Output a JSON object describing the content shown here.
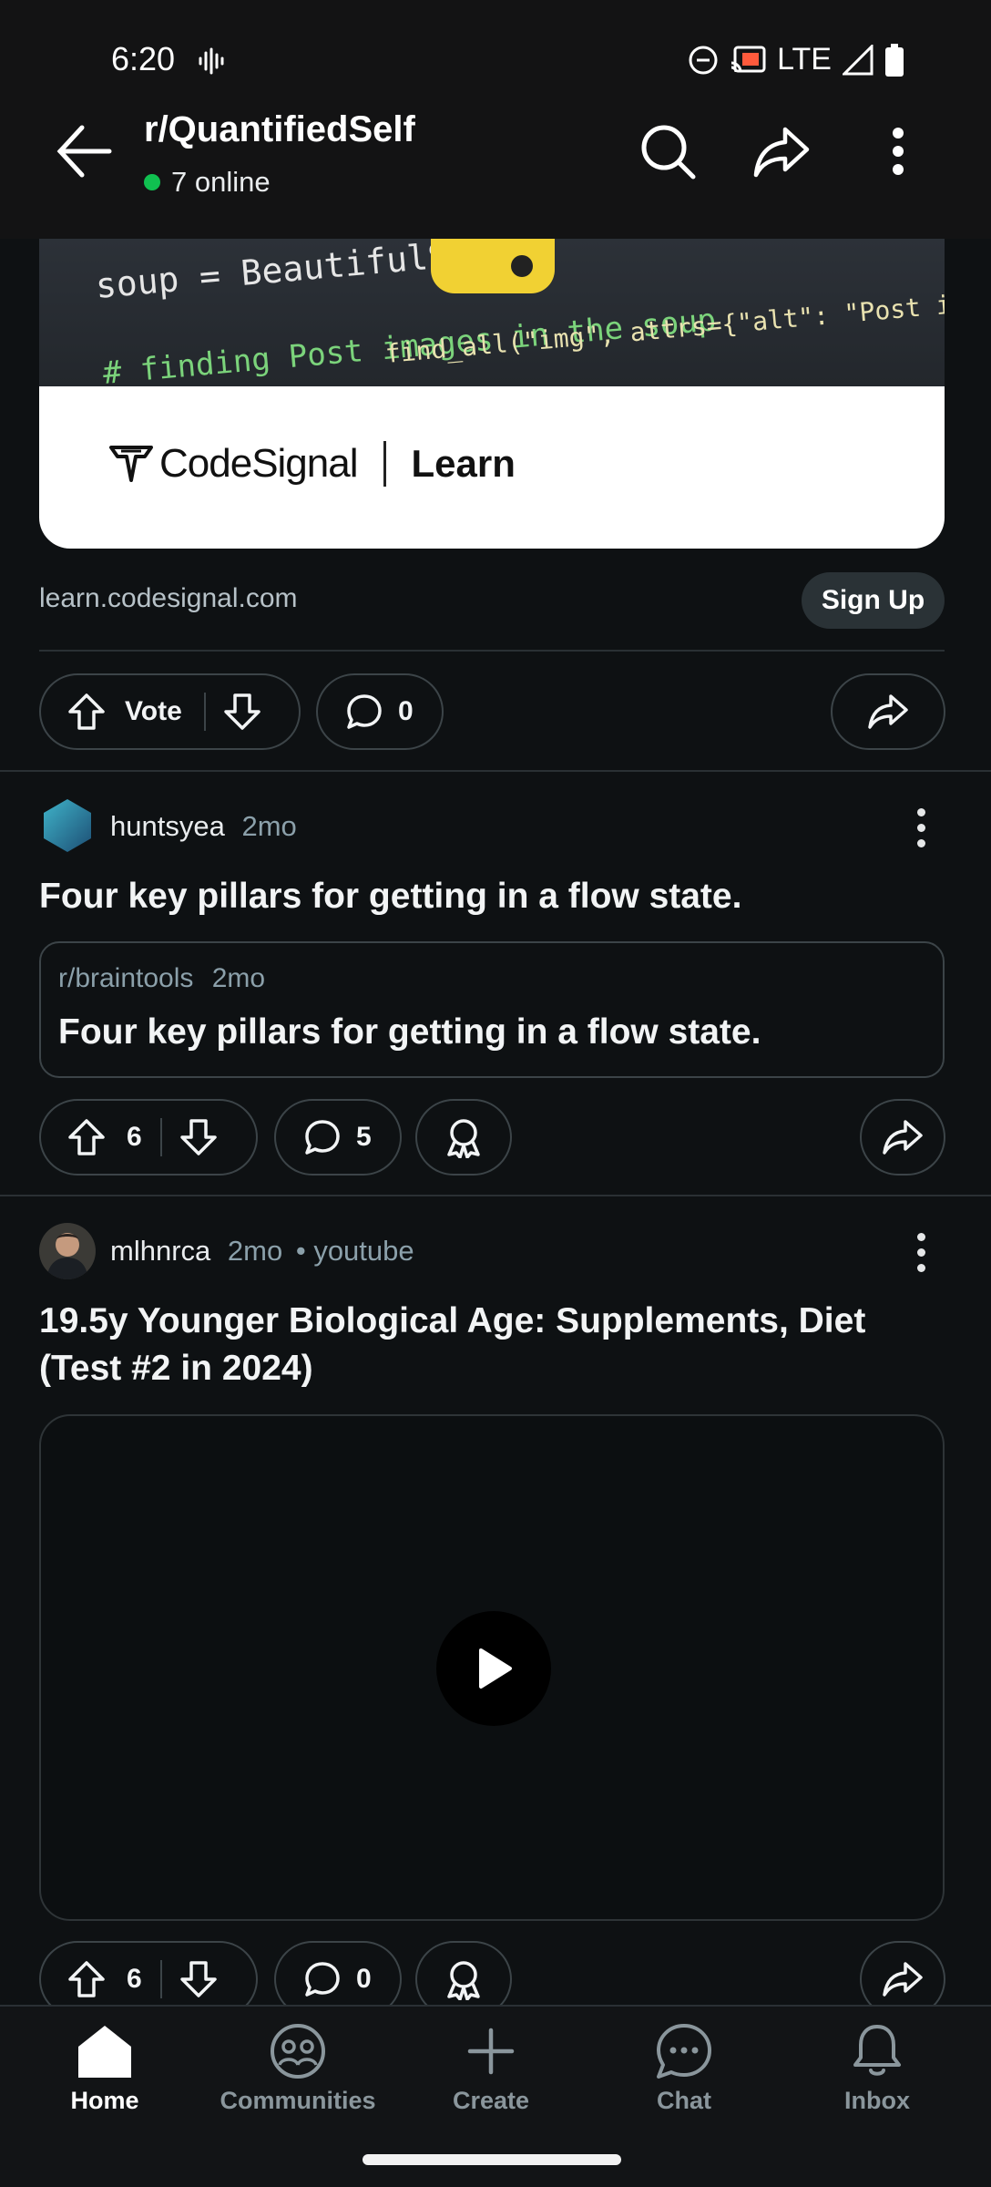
{
  "status_bar": {
    "time": "6:20",
    "network": "LTE"
  },
  "header": {
    "subreddit": "r/QuantifiedSelf",
    "online": "7 online"
  },
  "ad": {
    "code_lines": [
      "soup = BeautifulS",
      "# finding Post images in the soup",
      "find_all(\"img\", attrs={\"alt\": \"Post image\"})"
    ],
    "brand": "CodeSignal",
    "product": "Learn",
    "domain": "learn.codesignal.com",
    "cta": "Sign Up",
    "vote_label": "Vote",
    "comments": "0"
  },
  "posts": [
    {
      "author": "huntsyea",
      "age": "2mo",
      "title": "Four key pillars for getting in a flow state.",
      "crosspost": {
        "subreddit": "r/braintools",
        "age": "2mo",
        "title": "Four key pillars for getting in a flow state."
      },
      "votes": "6",
      "comments": "5"
    },
    {
      "author": "mlhnrca",
      "age": "2mo",
      "source": "youtube",
      "title_line1": "19.5y Younger Biological Age: Supplements, Diet",
      "title_line2": "(Test #2 in 2024)",
      "votes": "6",
      "comments": "0"
    }
  ],
  "nav": [
    {
      "label": "Home",
      "icon": "home-icon",
      "active": true
    },
    {
      "label": "Communities",
      "icon": "communities-icon"
    },
    {
      "label": "Create",
      "icon": "plus-icon"
    },
    {
      "label": "Chat",
      "icon": "chat-icon"
    },
    {
      "label": "Inbox",
      "icon": "bell-icon"
    }
  ],
  "colors": {
    "background": "#0e1113",
    "online_dot": "#10c050",
    "pill_border": "#3c4448"
  }
}
